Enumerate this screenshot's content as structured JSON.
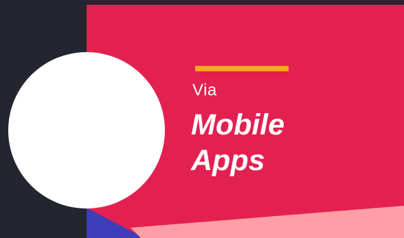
{
  "card": {
    "subtitle": "Via",
    "title_line1": "Mobile",
    "title_line2": "Apps"
  },
  "colors": {
    "background": "#23262e",
    "panel": "#e22150",
    "accent_bar": "#f5a623",
    "bottom_band": "#ff9ea6",
    "bottom_triangle": "#3d3db7",
    "circle": "#ffffff",
    "text": "#ffffff"
  }
}
